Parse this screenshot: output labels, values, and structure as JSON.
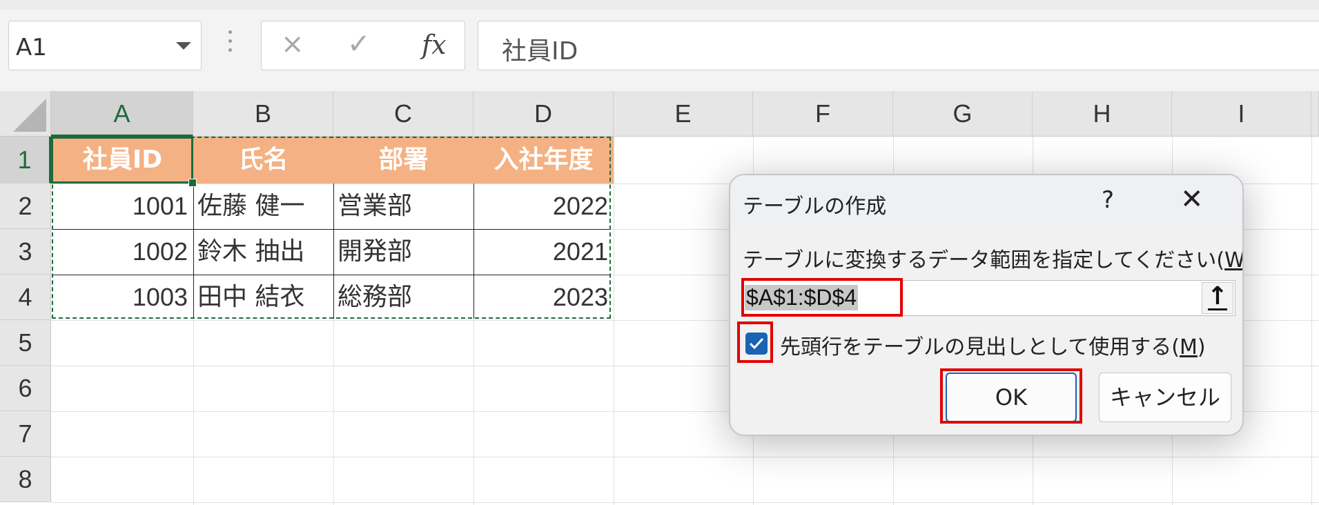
{
  "formula_bar": {
    "name_box": "A1",
    "cancel_icon": "×",
    "enter_icon": "✓",
    "fx_label": "fx",
    "formula": "社員ID"
  },
  "columns": [
    "A",
    "B",
    "C",
    "D",
    "E",
    "F",
    "G",
    "H",
    "I"
  ],
  "rows": [
    "1",
    "2",
    "3",
    "4",
    "5",
    "6",
    "7",
    "8"
  ],
  "table": {
    "headers": [
      "社員ID",
      "氏名",
      "部署",
      "入社年度"
    ],
    "rows": [
      [
        "1001",
        "佐藤 健一",
        "営業部",
        "2022"
      ],
      [
        "1002",
        "鈴木 抽出",
        "開発部",
        "2021"
      ],
      [
        "1003",
        "田中 結衣",
        "総務部",
        "2023"
      ]
    ]
  },
  "dialog": {
    "title": "テーブルの作成",
    "help": "?",
    "close": "✕",
    "prompt": "テーブルに変換するデータ範囲を指定してください(",
    "prompt_key": "W",
    "prompt_end": ")",
    "range": "$A$1:$D$4",
    "collapse_icon": "🡅",
    "checkbox_checked": true,
    "checkbox_label": "先頭行をテーブルの見出しとして使用する(",
    "checkbox_key": "M",
    "checkbox_end": ")",
    "ok": "OK",
    "cancel": "キャンセル"
  },
  "colors": {
    "header_fill": "#f4b183",
    "accent_green": "#1d6b3a",
    "highlight_red": "#e00000",
    "checkbox_blue": "#1a63b4"
  }
}
